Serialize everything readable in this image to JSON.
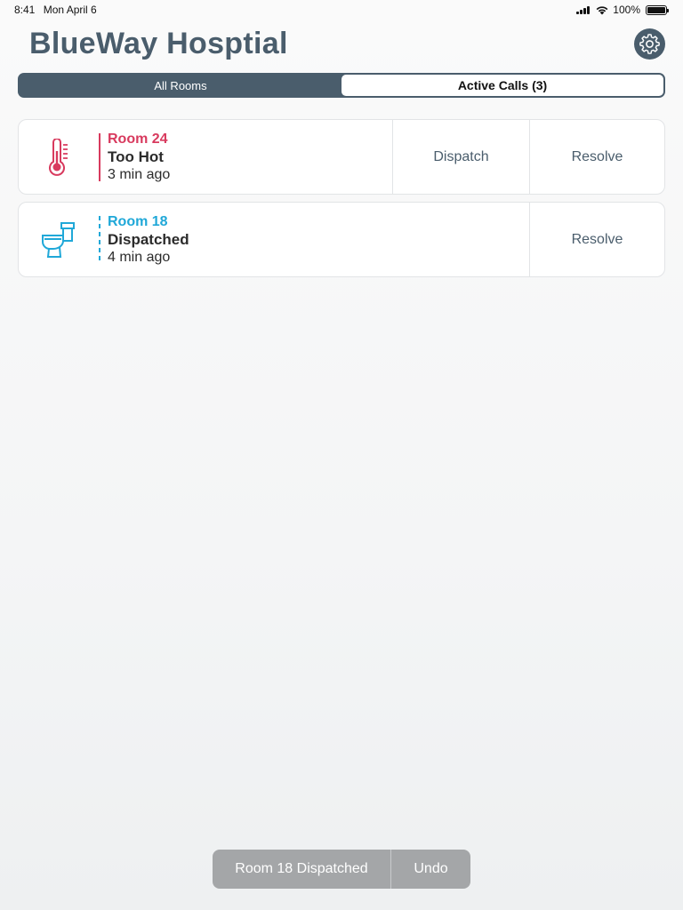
{
  "status_bar": {
    "time": "8:41",
    "date": "Mon April 6",
    "battery": "100%"
  },
  "header": {
    "title": "BlueWay Hosptial",
    "settings_icon": "gear-icon"
  },
  "tabs": [
    {
      "label": "All Rooms",
      "active": false
    },
    {
      "label": "Active Calls (3)",
      "active": true
    }
  ],
  "calls": [
    {
      "room": "Room 24",
      "status": "Too Hot",
      "time": "3 min ago",
      "icon": "thermometer-icon",
      "color": "#d83a5e",
      "dispatch_label": "Dispatch",
      "resolve_label": "Resolve"
    },
    {
      "room": "Room 18",
      "status": "Dispatched",
      "time": "4 min ago",
      "icon": "toilet-icon",
      "color": "#20a8d8",
      "resolve_label": "Resolve"
    }
  ],
  "toast": {
    "message": "Room 18 Dispatched",
    "undo_label": "Undo"
  },
  "colors": {
    "primary": "#4a5d6c",
    "alert": "#d83a5e",
    "info": "#20a8d8"
  }
}
